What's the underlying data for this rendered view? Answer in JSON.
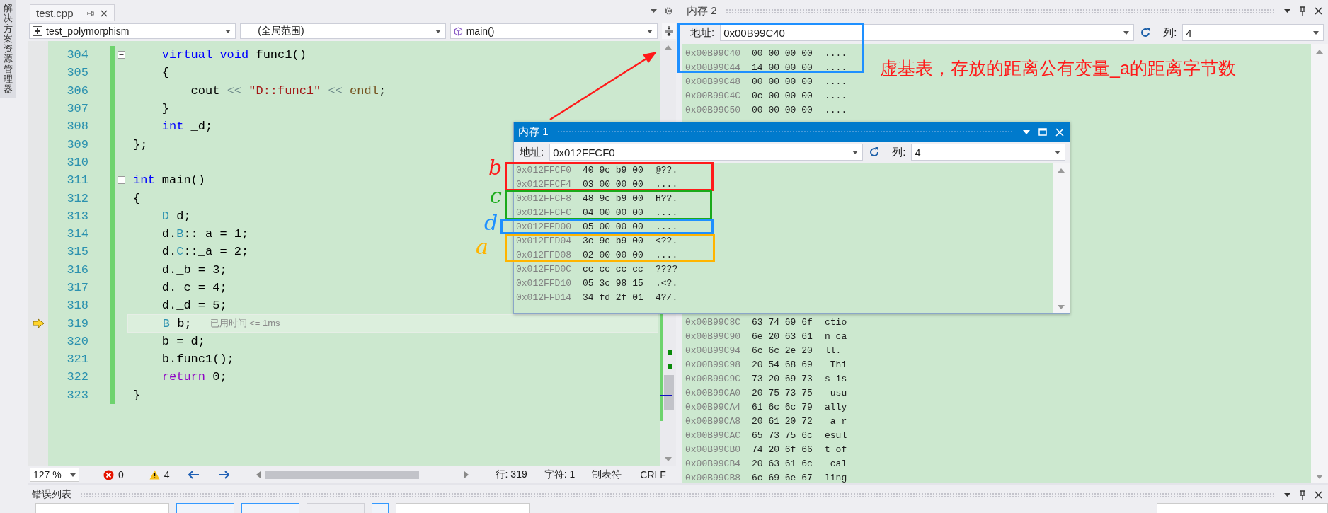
{
  "side_panel": {
    "tab": "解决方案资源管理器"
  },
  "editor": {
    "tab": {
      "title": "test.cpp",
      "selected": true
    },
    "nav": {
      "project": "test_polymorphism",
      "scope": "(全局范围)",
      "member": "main()"
    },
    "lines": [
      {
        "number": "304",
        "fold": true,
        "current": false,
        "tokens": [
          {
            "kind": "kw",
            "text": "    virtual void"
          },
          {
            "kind": "plain",
            "text": " func1()"
          }
        ]
      },
      {
        "number": "305",
        "fold": false,
        "current": false,
        "tokens": [
          {
            "kind": "plain",
            "text": "    {"
          }
        ]
      },
      {
        "number": "306",
        "fold": false,
        "current": false,
        "tokens": [
          {
            "kind": "plain",
            "text": "        cout "
          },
          {
            "kind": "op",
            "text": "<< "
          },
          {
            "kind": "str",
            "text": "\"D::func1\""
          },
          {
            "kind": "op",
            "text": " << "
          },
          {
            "kind": "macro",
            "text": "endl"
          },
          {
            "kind": "plain",
            "text": ";"
          }
        ]
      },
      {
        "number": "307",
        "fold": false,
        "current": false,
        "tokens": [
          {
            "kind": "plain",
            "text": "    }"
          }
        ]
      },
      {
        "number": "308",
        "fold": false,
        "current": false,
        "tokens": [
          {
            "kind": "kw",
            "text": "    int"
          },
          {
            "kind": "plain",
            "text": " _d;"
          }
        ]
      },
      {
        "number": "309",
        "fold": false,
        "current": false,
        "tokens": [
          {
            "kind": "plain",
            "text": "};"
          }
        ]
      },
      {
        "number": "310",
        "fold": false,
        "current": false
      },
      {
        "number": "311",
        "fold": true,
        "current": false,
        "tokens": [
          {
            "kind": "kw",
            "text": "int"
          },
          {
            "kind": "plain",
            "text": " main()"
          }
        ]
      },
      {
        "number": "312",
        "fold": false,
        "current": false,
        "tokens": [
          {
            "kind": "plain",
            "text": "{"
          }
        ]
      },
      {
        "number": "313",
        "fold": false,
        "current": false,
        "tokens": [
          {
            "kind": "type",
            "text": "    D"
          },
          {
            "kind": "plain",
            "text": " d;"
          }
        ]
      },
      {
        "number": "314",
        "fold": false,
        "current": false,
        "tokens": [
          {
            "kind": "plain",
            "text": "    d."
          },
          {
            "kind": "type",
            "text": "B"
          },
          {
            "kind": "plain",
            "text": "::_a = 1;"
          }
        ]
      },
      {
        "number": "315",
        "fold": false,
        "current": false,
        "tokens": [
          {
            "kind": "plain",
            "text": "    d."
          },
          {
            "kind": "type",
            "text": "C"
          },
          {
            "kind": "plain",
            "text": "::_a = 2;"
          }
        ]
      },
      {
        "number": "316",
        "fold": false,
        "current": false,
        "tokens": [
          {
            "kind": "plain",
            "text": "    d._b = 3;"
          }
        ]
      },
      {
        "number": "317",
        "fold": false,
        "current": false,
        "tokens": [
          {
            "kind": "plain",
            "text": "    d._c = 4;"
          }
        ]
      },
      {
        "number": "318",
        "fold": false,
        "current": false,
        "tokens": [
          {
            "kind": "plain",
            "text": "    d._d = 5;"
          }
        ]
      },
      {
        "number": "319",
        "fold": false,
        "current": true,
        "hint": "已用时间 <= 1ms",
        "tokens": [
          {
            "kind": "type",
            "text": "    B"
          },
          {
            "kind": "plain",
            "text": " b;"
          }
        ]
      },
      {
        "number": "320",
        "fold": false,
        "current": false,
        "tokens": [
          {
            "kind": "plain",
            "text": "    b = d;"
          }
        ]
      },
      {
        "number": "321",
        "fold": false,
        "current": false,
        "tokens": [
          {
            "kind": "plain",
            "text": "    b.func1();"
          }
        ]
      },
      {
        "number": "322",
        "fold": false,
        "current": false,
        "tokens": [
          {
            "kind": "ret",
            "text": "    return"
          },
          {
            "kind": "plain",
            "text": " 0;"
          }
        ]
      },
      {
        "number": "323",
        "fold": false,
        "current": false,
        "tokens": [
          {
            "kind": "plain",
            "text": "}"
          }
        ]
      }
    ],
    "status_bar": {
      "zoom": "127 %",
      "errors": "0",
      "warnings": "4",
      "line": "行: 319",
      "column": "字符: 1",
      "indent": "制表符",
      "line_ending": "CRLF"
    }
  },
  "memory_windows": [
    {
      "kind": "docked",
      "title": "内存 2",
      "address_label": "地址:",
      "address": "0x00B99C40",
      "columns_label": "列:",
      "columns": "4",
      "rows": [
        {
          "address": "0x00B99C40",
          "bytes": "00 00 00 00",
          "text": "...."
        },
        {
          "address": "0x00B99C44",
          "bytes": "14 00 00 00",
          "text": "...."
        },
        {
          "address": "0x00B99C48",
          "bytes": "00 00 00 00",
          "text": "...."
        },
        {
          "address": "0x00B99C4C",
          "bytes": "0c 00 00 00",
          "text": "...."
        },
        {
          "address": "0x00B99C50",
          "bytes": "00 00 00 00",
          "text": "...."
        }
      ],
      "rows_after_gap": [
        {
          "address": "0x00B99C8C",
          "bytes": "63 74 69 6f",
          "text": "ctio"
        },
        {
          "address": "0x00B99C90",
          "bytes": "6e 20 63 61",
          "text": "n ca"
        },
        {
          "address": "0x00B99C94",
          "bytes": "6c 6c 2e 20",
          "text": "ll."
        },
        {
          "address": "0x00B99C98",
          "bytes": "20 54 68 69",
          "text": " Thi"
        },
        {
          "address": "0x00B99C9C",
          "bytes": "73 20 69 73",
          "text": "s is"
        },
        {
          "address": "0x00B99CA0",
          "bytes": "20 75 73 75",
          "text": " usu"
        },
        {
          "address": "0x00B99CA4",
          "bytes": "61 6c 6c 79",
          "text": "ally"
        },
        {
          "address": "0x00B99CA8",
          "bytes": "20 61 20 72",
          "text": " a r"
        },
        {
          "address": "0x00B99CAC",
          "bytes": "65 73 75 6c",
          "text": "esul"
        },
        {
          "address": "0x00B99CB0",
          "bytes": "74 20 6f 66",
          "text": "t of"
        },
        {
          "address": "0x00B99CB4",
          "bytes": "20 63 61 6c",
          "text": " cal"
        },
        {
          "address": "0x00B99CB8",
          "bytes": "6c 69 6e 67",
          "text": "ling"
        }
      ]
    },
    {
      "kind": "floating",
      "title": "内存 1",
      "address_label": "地址:",
      "address": "0x012FFCF0",
      "columns_label": "列:",
      "columns": "4",
      "rows": [
        {
          "address": "0x012FFCF0",
          "bytes": "40 9c b9 00",
          "text": "@??."
        },
        {
          "address": "0x012FFCF4",
          "bytes": "03 00 00 00",
          "text": "...."
        },
        {
          "address": "0x012FFCF8",
          "bytes": "48 9c b9 00",
          "text": "H??."
        },
        {
          "address": "0x012FFCFC",
          "bytes": "04 00 00 00",
          "text": "...."
        },
        {
          "address": "0x012FFD00",
          "bytes": "05 00 00 00",
          "text": "...."
        },
        {
          "address": "0x012FFD04",
          "bytes": "3c 9c b9 00",
          "text": "<??."
        },
        {
          "address": "0x012FFD08",
          "bytes": "02 00 00 00",
          "text": "...."
        },
        {
          "address": "0x012FFD0C",
          "bytes": "cc cc cc cc",
          "text": "????"
        },
        {
          "address": "0x012FFD10",
          "bytes": "05 3c 98 15",
          "text": ".<?."
        },
        {
          "address": "0x012FFD14",
          "bytes": "34 fd 2f 01",
          "text": "4?/."
        }
      ]
    }
  ],
  "bottom_panel": {
    "title": "错误列表"
  },
  "annotations": {
    "note": "虚基表，存放的距离公有变量_a的距离字节数",
    "frames": [
      {
        "color": "#1e90ff"
      },
      {
        "color": "#ff1a1a"
      },
      {
        "color": "#1aaa1a"
      },
      {
        "color": "#1e90ff"
      },
      {
        "color": "#ffb400"
      }
    ],
    "letters": [
      {
        "text": "b",
        "color": "#ff1a1a"
      },
      {
        "text": "c",
        "color": "#1aaa1a"
      },
      {
        "text": "d",
        "color": "#1e90ff"
      },
      {
        "text": "a",
        "color": "#ffb400"
      }
    ]
  }
}
